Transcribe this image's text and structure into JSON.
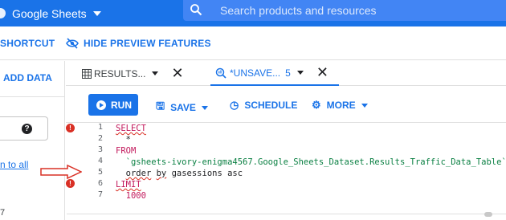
{
  "header": {
    "app_title": "Google Sheets",
    "search_placeholder": "Search products and resources",
    "brand_color": "#1a73e8"
  },
  "toolbar": {
    "shortcut_label": "SHORTCUT",
    "hide_preview_label": "HIDE PREVIEW FEATURES"
  },
  "left_panel": {
    "add_data_label": "ADD DATA",
    "link_text": "n to all",
    "partial_number": "7",
    "help_glyph": "?"
  },
  "tabs": [
    {
      "label": "RESULTS...",
      "icon": "table-icon"
    },
    {
      "label": "*UNSAVE...",
      "count": "5",
      "icon": "query-icon"
    }
  ],
  "actions": {
    "run_label": "RUN",
    "save_label": "SAVE",
    "schedule_label": "SCHEDULE",
    "more_label": "MORE"
  },
  "editor": {
    "line_numbers": [
      "1",
      "2",
      "3",
      "4",
      "5",
      "6",
      "7"
    ],
    "error_lines": [
      "1",
      "5",
      "6"
    ],
    "lines": {
      "l1": "SELECT",
      "l2": "  *",
      "l3": "FROM",
      "l4": "  `gsheets-ivory-enigma4567.Google_Sheets_Dataset.Results_Traffic_Data_Table`",
      "l5_kw1": "order",
      "l5_kw2": "by",
      "l5_rest": "gasessions asc",
      "l6": "LIMIT",
      "l7": "  1000"
    }
  }
}
